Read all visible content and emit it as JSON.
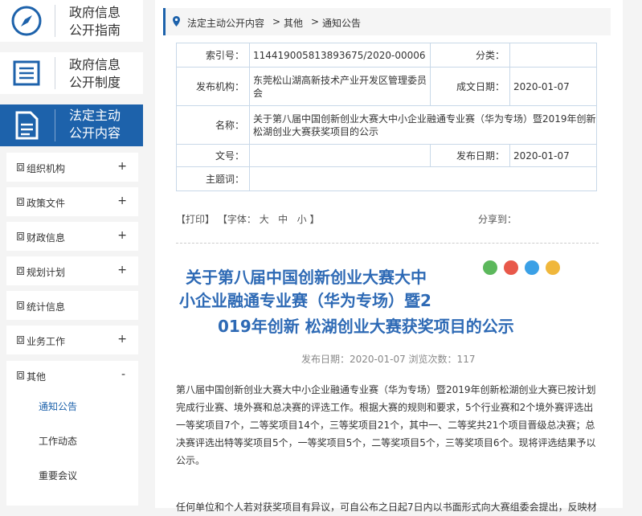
{
  "sidebar": {
    "cards": [
      {
        "line1": "政府信息",
        "line2": "公开指南"
      },
      {
        "line1": "政府信息",
        "line2": "公开制度"
      },
      {
        "line1": "法定主动",
        "line2": "公开内容"
      }
    ],
    "menu": [
      {
        "label": "组织机构",
        "toggle": "+"
      },
      {
        "label": "政策文件",
        "toggle": "+"
      },
      {
        "label": "财政信息",
        "toggle": "+"
      },
      {
        "label": "规划计划",
        "toggle": "+"
      },
      {
        "label": "统计信息",
        "toggle": ""
      },
      {
        "label": "业务工作",
        "toggle": "+"
      },
      {
        "label": "其他",
        "toggle": "-"
      }
    ],
    "submenu": [
      "通知公告",
      "工作动态",
      "重要会议"
    ],
    "accent_color": "#1d62ab",
    "active_sub_color": "#1d62ab"
  },
  "breadcrumb": {
    "items": [
      "法定主动公开内容",
      "其他",
      "通知公告"
    ],
    "sep": ">"
  },
  "meta": {
    "index_label": "索引号：",
    "index_value": "11441900581389367​5/2020-00006",
    "category_label": "分类：",
    "category_value": "",
    "org_label": "发布机构：",
    "org_value": "东莞松山湖高新技术产业开发区管理委员会",
    "date_label": "成文日期：",
    "date_value": "2020-01-07",
    "name_label": "名称：",
    "name_value": "关于第八届中国创新创业大赛大中小企业融通专业赛（华为专场）暨2019年创新松湖创业大赛获奖项目的公示",
    "docno_label": "文号：",
    "docno_value": "",
    "pub_label": "发布日期：",
    "pub_value": "2020-01-07",
    "keyword_label": "主题词：",
    "keyword_value": ""
  },
  "tools": {
    "print": "【打印】",
    "font": "【字体：",
    "big": "大",
    "mid": "中",
    "small": "小",
    "close": "】",
    "share": "分享到："
  },
  "article": {
    "title_l1": "关于第八届中国创新创业大赛大中",
    "title_l2": "小企业融通专业赛（华为专场）暨2",
    "title_l3": "019年创新 松湖创业大赛获奖项目的公示",
    "pubinfo": "发布日期：2020-01-07  浏览次数：117",
    "para1": "第八届中国创新创业大赛大中小企业融通专业赛（华为专场）暨2019年创新松湖创业大赛已按计划完成行业赛、境外赛和总决赛的评选工作。根据大赛的规则和要求，5个行业赛和2个境外赛评选出一等奖项目7个，二等奖项目14个，三等奖项目21个，其中一、二等奖共21个项目晋级总决赛；总决赛评选出特等奖项目5个，一等奖项目5个，二等奖项目5个，三等奖项目6个。现将评选结果予以公示。",
    "para2": "任何单位和个人若对获奖项目有异议，可自公布之日起7日内以书面形式向大赛组委会提出，反映材"
  },
  "share_icons": [
    "wechat-icon",
    "weibo-icon",
    "qq-icon",
    "qzone-icon"
  ]
}
